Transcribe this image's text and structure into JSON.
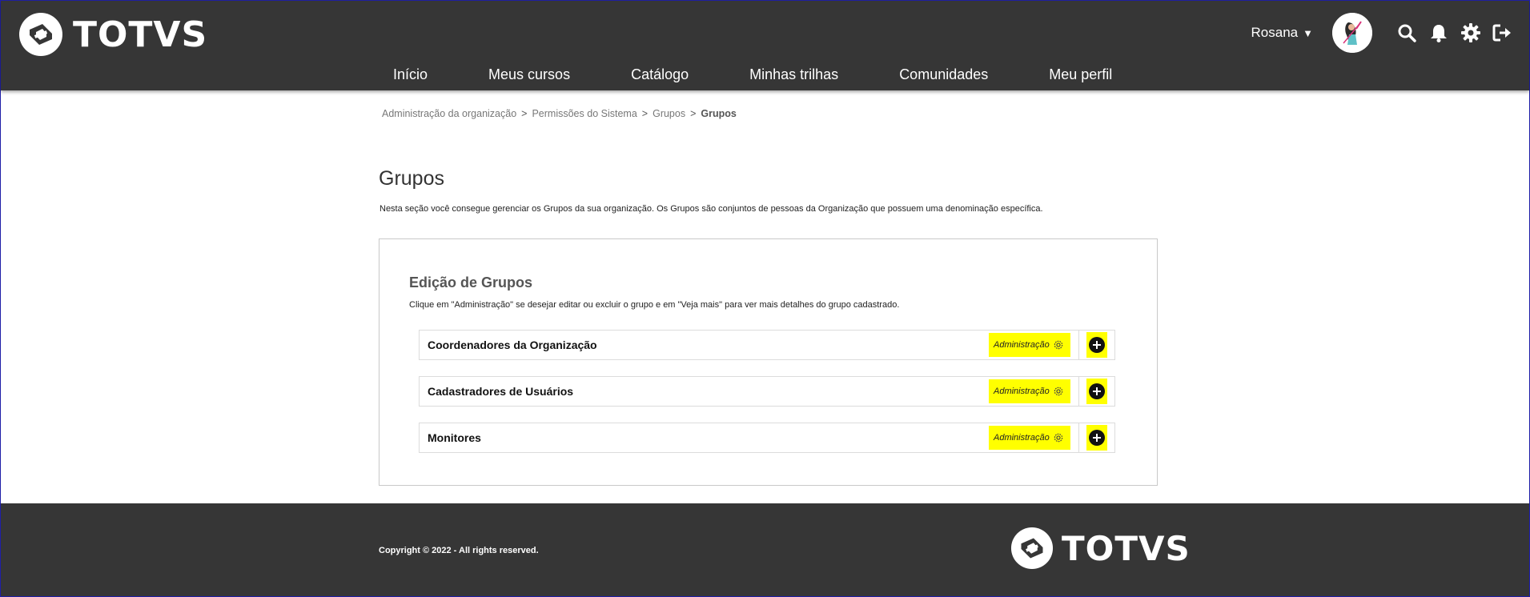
{
  "header": {
    "logo_text": "TOTVS",
    "user_name": "Rosana",
    "user_caret": "▼",
    "icons": [
      "search-icon",
      "bell-icon",
      "gear-icon",
      "logout-icon"
    ]
  },
  "nav": {
    "items": [
      "Início",
      "Meus cursos",
      "Catálogo",
      "Minhas trilhas",
      "Comunidades",
      "Meu perfil"
    ]
  },
  "breadcrumb": {
    "items": [
      "Administração da organização",
      "Permissões do Sistema",
      "Grupos"
    ],
    "current": "Grupos",
    "separator": ">"
  },
  "page": {
    "title": "Grupos",
    "description": "Nesta seção você consegue gerenciar os Grupos da sua organização. Os Grupos são conjuntos de pessoas da Organização que possuem uma denominação específica."
  },
  "card": {
    "title": "Edição de Grupos",
    "description": "Clique em \"Administração\" se desejar editar ou excluir o grupo e em \"Veja mais\" para ver mais detalhes do grupo cadastrado.",
    "groups": [
      {
        "name": "Coordenadores da Organização",
        "admin_label": "Administração"
      },
      {
        "name": "Cadastradores de Usuários",
        "admin_label": "Administração"
      },
      {
        "name": "Monitores",
        "admin_label": "Administração"
      }
    ]
  },
  "footer": {
    "copyright": "Copyright © 2022 - All rights reserved.",
    "logo_text": "TOTVS"
  },
  "colors": {
    "header_bg": "#363636",
    "highlight": "#ffff00",
    "text_dark": "#222222"
  }
}
